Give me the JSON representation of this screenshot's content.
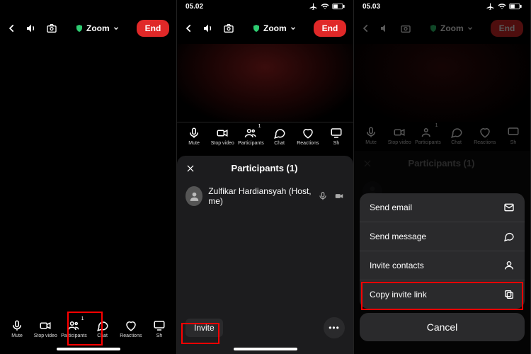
{
  "common": {
    "zoom_label": "Zoom",
    "end_label": "End",
    "toolbar": {
      "mute": "Mute",
      "stop_video": "Stop video",
      "participants": "Participants",
      "participants_count": "1",
      "chat": "Chat",
      "reactions": "Reactions",
      "share": "Sh"
    }
  },
  "screen1": {
    "statusbar_time": "",
    "show_statusbar": false
  },
  "screen2": {
    "statusbar_time": "05.02",
    "sheet_title": "Participants (1)",
    "participant": {
      "name": "Zulfikar Hardiansyah (Host, me)"
    },
    "invite_label": "Invite"
  },
  "screen3": {
    "statusbar_time": "05.03",
    "sheet_title": "Participants (1)",
    "actions": {
      "send_email": "Send email",
      "send_message": "Send message",
      "invite_contacts": "Invite contacts",
      "copy_invite_link": "Copy invite link",
      "cancel": "Cancel"
    }
  }
}
